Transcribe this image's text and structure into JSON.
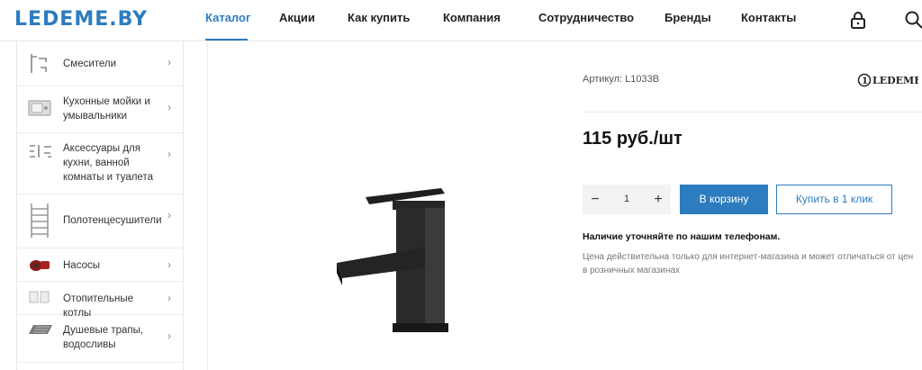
{
  "header": {
    "logo": "LEDEME.BY",
    "nav": [
      {
        "label": "Каталог",
        "active": true
      },
      {
        "label": "Акции"
      },
      {
        "label": "Как купить"
      },
      {
        "label": "Компания"
      },
      {
        "label": "Сотрудничество"
      },
      {
        "label": "Бренды"
      },
      {
        "label": "Контакты"
      }
    ],
    "icons": [
      "lock-icon",
      "search-icon"
    ],
    "accent_color": "#2d7cc0"
  },
  "sidebar": {
    "items": [
      {
        "label": "Смесители",
        "icon": "faucet-thumb"
      },
      {
        "label": "Кухонные мойки и умывальники",
        "icon": "sink-thumb"
      },
      {
        "label": "Аксессуары для кухни, ванной комнаты и туалета",
        "icon": "accessories-thumb"
      },
      {
        "label": "Полотенцесушители",
        "icon": "towel-dryer-thumb"
      },
      {
        "label": "Насосы",
        "icon": "pump-thumb"
      },
      {
        "label": "Отопительные котлы",
        "icon": "boiler-thumb"
      },
      {
        "label": "Душевые трапы, водосливы",
        "icon": "drain-thumb"
      }
    ]
  },
  "product": {
    "sku": "Артикул: L1033B",
    "brand": "LEDEME",
    "price": "115 руб./шт",
    "quantity": "1",
    "cart_label": "В корзину",
    "oneclick_label": "Купить в 1 клик",
    "availability": "Наличие уточняйте по нашим телефонам.",
    "price_note": "Цена действительна только для интернет-магазина и может отличаться от цен в розничных магазинах"
  }
}
